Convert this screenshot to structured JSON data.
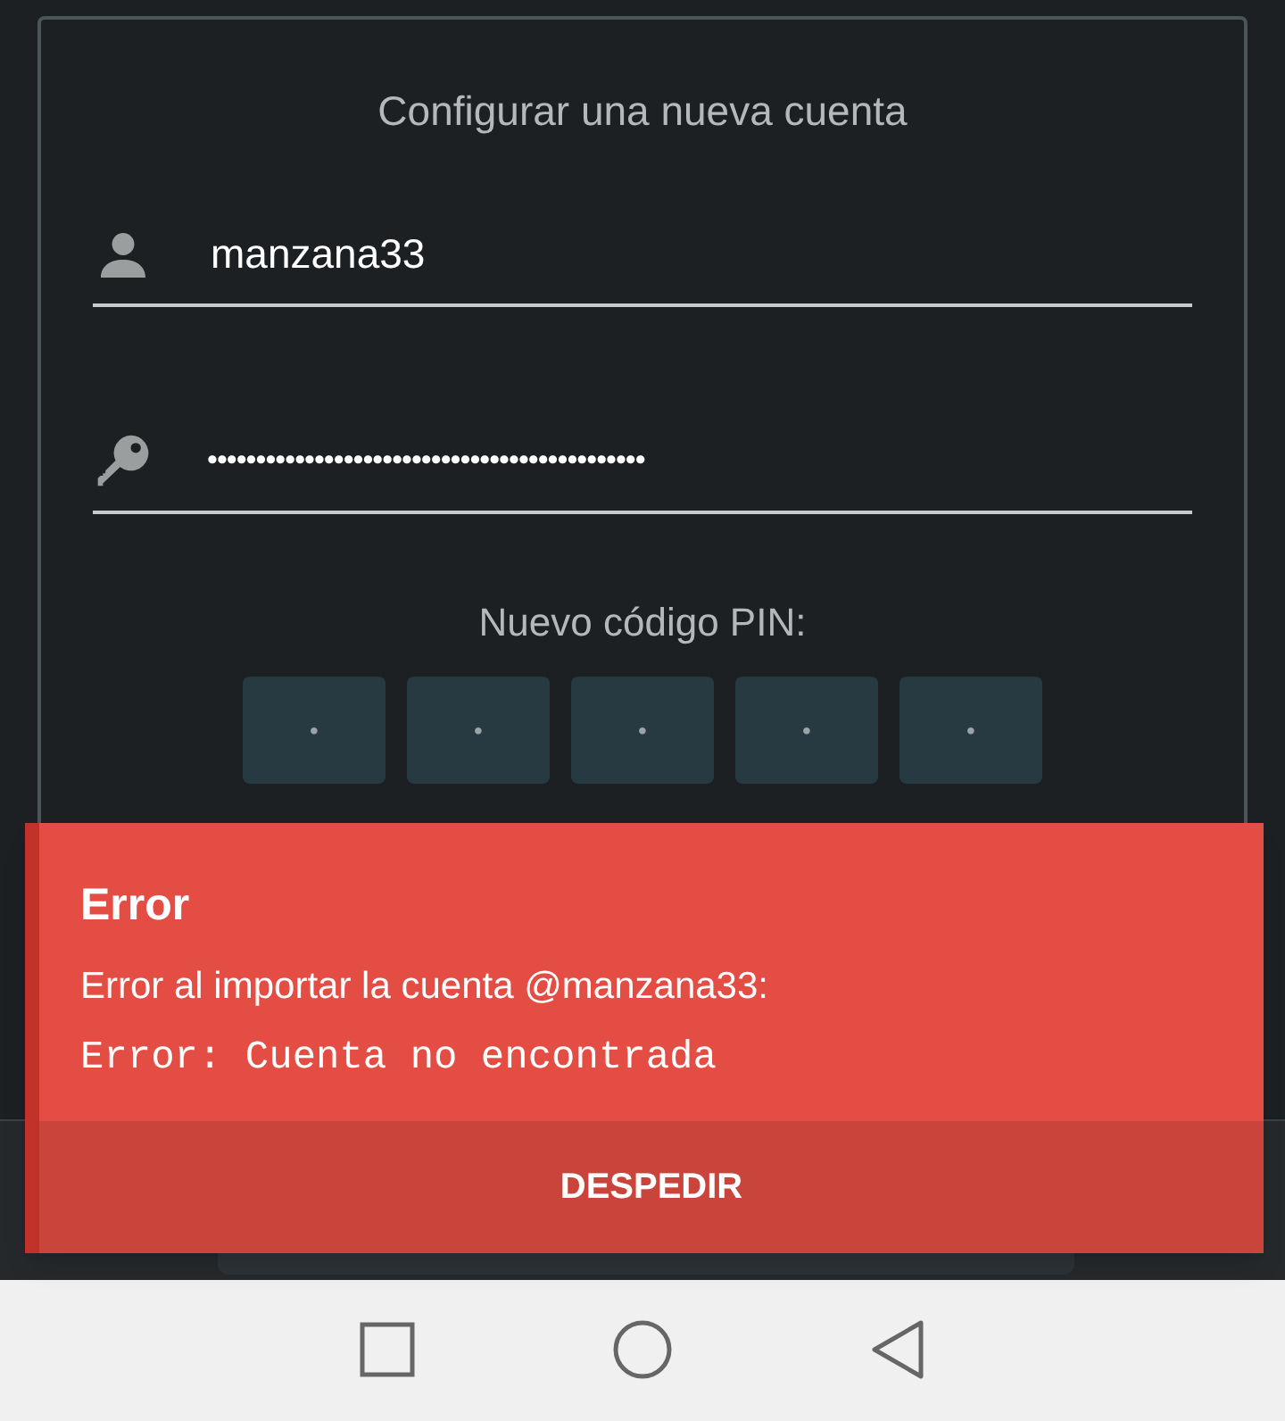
{
  "setup_card": {
    "title": "Configurar una nueva cuenta",
    "username": "manzana33",
    "password": "•••••••••••••••••••••••••••••••••••••••••••••",
    "pin_label": "Nuevo código PIN:",
    "pin_boxes": [
      {
        "placeholder": "•"
      },
      {
        "placeholder": "•"
      },
      {
        "placeholder": "•"
      },
      {
        "placeholder": "•"
      },
      {
        "placeholder": "•"
      }
    ]
  },
  "error_toast": {
    "title": "Error",
    "message": "Error al importar la cuenta @manzana33:",
    "detail": "Error: Cuenta no encontrada",
    "action": "DESPEDIR"
  }
}
